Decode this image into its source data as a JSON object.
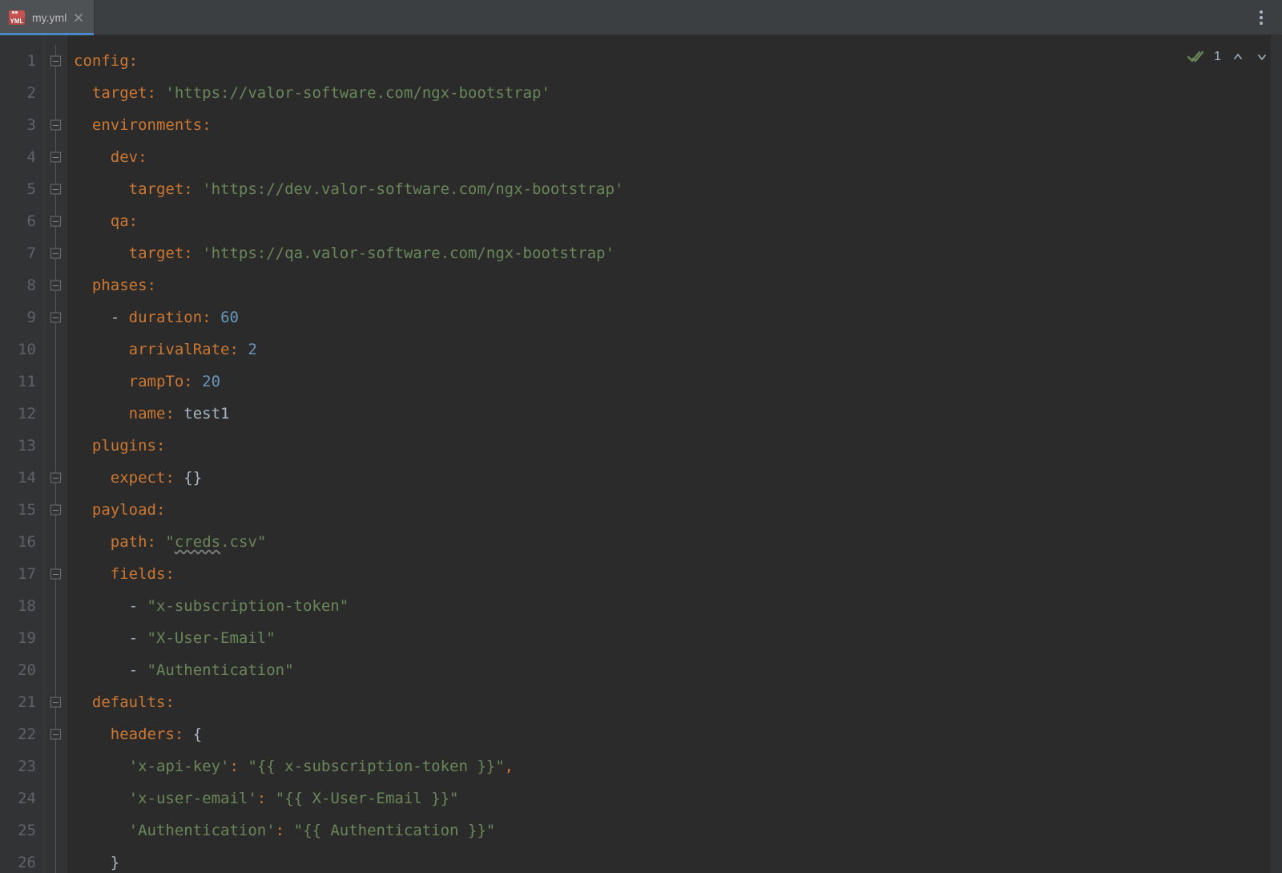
{
  "tab": {
    "filename": "my.yml",
    "icon_label": "YML"
  },
  "inspections": {
    "count": "1"
  },
  "gutter": {
    "start": 1,
    "end": 26
  },
  "fold_rows": [
    1,
    3,
    4,
    5,
    6,
    7,
    8,
    9,
    14,
    15,
    17,
    21,
    22
  ],
  "code_lines": [
    [
      {
        "t": "config",
        "c": "k"
      },
      {
        "t": ":",
        "c": "p"
      }
    ],
    [
      {
        "t": "  ",
        "c": "d"
      },
      {
        "t": "target",
        "c": "k"
      },
      {
        "t": ": ",
        "c": "p"
      },
      {
        "t": "'https://valor-software.com/ngx-bootstrap'",
        "c": "s"
      }
    ],
    [
      {
        "t": "  ",
        "c": "d"
      },
      {
        "t": "environments",
        "c": "k"
      },
      {
        "t": ":",
        "c": "p"
      }
    ],
    [
      {
        "t": "    ",
        "c": "d"
      },
      {
        "t": "dev",
        "c": "k"
      },
      {
        "t": ":",
        "c": "p"
      }
    ],
    [
      {
        "t": "      ",
        "c": "d"
      },
      {
        "t": "target",
        "c": "k"
      },
      {
        "t": ": ",
        "c": "p"
      },
      {
        "t": "'https://dev.valor-software.com/ngx-bootstrap'",
        "c": "s"
      }
    ],
    [
      {
        "t": "    ",
        "c": "d"
      },
      {
        "t": "qa",
        "c": "k"
      },
      {
        "t": ":",
        "c": "p"
      }
    ],
    [
      {
        "t": "      ",
        "c": "d"
      },
      {
        "t": "target",
        "c": "k"
      },
      {
        "t": ": ",
        "c": "p"
      },
      {
        "t": "'https://qa.valor-software.com/ngx-bootstrap'",
        "c": "s"
      }
    ],
    [
      {
        "t": "  ",
        "c": "d"
      },
      {
        "t": "phases",
        "c": "k"
      },
      {
        "t": ":",
        "c": "p"
      }
    ],
    [
      {
        "t": "    ",
        "c": "d"
      },
      {
        "t": "- ",
        "c": "dash"
      },
      {
        "t": "duration",
        "c": "k"
      },
      {
        "t": ": ",
        "c": "p"
      },
      {
        "t": "60",
        "c": "n"
      }
    ],
    [
      {
        "t": "      ",
        "c": "d"
      },
      {
        "t": "arrivalRate",
        "c": "k"
      },
      {
        "t": ": ",
        "c": "p"
      },
      {
        "t": "2",
        "c": "n"
      }
    ],
    [
      {
        "t": "      ",
        "c": "d"
      },
      {
        "t": "rampTo",
        "c": "k"
      },
      {
        "t": ": ",
        "c": "p"
      },
      {
        "t": "20",
        "c": "n"
      }
    ],
    [
      {
        "t": "      ",
        "c": "d"
      },
      {
        "t": "name",
        "c": "k"
      },
      {
        "t": ": ",
        "c": "p"
      },
      {
        "t": "test1",
        "c": "d"
      }
    ],
    [
      {
        "t": "  ",
        "c": "d"
      },
      {
        "t": "plugins",
        "c": "k"
      },
      {
        "t": ":",
        "c": "p"
      }
    ],
    [
      {
        "t": "    ",
        "c": "d"
      },
      {
        "t": "expect",
        "c": "k"
      },
      {
        "t": ": ",
        "c": "p"
      },
      {
        "t": "{}",
        "c": "br"
      }
    ],
    [
      {
        "t": "  ",
        "c": "d"
      },
      {
        "t": "payload",
        "c": "k"
      },
      {
        "t": ":",
        "c": "p"
      }
    ],
    [
      {
        "t": "    ",
        "c": "d"
      },
      {
        "t": "path",
        "c": "k"
      },
      {
        "t": ": ",
        "c": "p"
      },
      {
        "t": "\"",
        "c": "s"
      },
      {
        "t": "creds",
        "c": "s warn"
      },
      {
        "t": ".csv\"",
        "c": "s"
      }
    ],
    [
      {
        "t": "    ",
        "c": "d"
      },
      {
        "t": "fields",
        "c": "k"
      },
      {
        "t": ":",
        "c": "p"
      }
    ],
    [
      {
        "t": "      ",
        "c": "d"
      },
      {
        "t": "- ",
        "c": "dash"
      },
      {
        "t": "\"x-subscription-token\"",
        "c": "s"
      }
    ],
    [
      {
        "t": "      ",
        "c": "d"
      },
      {
        "t": "- ",
        "c": "dash"
      },
      {
        "t": "\"X-User-Email\"",
        "c": "s"
      }
    ],
    [
      {
        "t": "      ",
        "c": "d"
      },
      {
        "t": "- ",
        "c": "dash"
      },
      {
        "t": "\"Authentication\"",
        "c": "s"
      }
    ],
    [
      {
        "t": "  ",
        "c": "d"
      },
      {
        "t": "defaults",
        "c": "k"
      },
      {
        "t": ":",
        "c": "p"
      }
    ],
    [
      {
        "t": "    ",
        "c": "d"
      },
      {
        "t": "headers",
        "c": "k"
      },
      {
        "t": ": ",
        "c": "p"
      },
      {
        "t": "{",
        "c": "br"
      }
    ],
    [
      {
        "t": "      ",
        "c": "d"
      },
      {
        "t": "'x-api-key'",
        "c": "s"
      },
      {
        "t": ": ",
        "c": "p"
      },
      {
        "t": "\"{{ x-subscription-token }}\"",
        "c": "s"
      },
      {
        "t": ",",
        "c": "comma"
      }
    ],
    [
      {
        "t": "      ",
        "c": "d"
      },
      {
        "t": "'x-user-email'",
        "c": "s"
      },
      {
        "t": ": ",
        "c": "p"
      },
      {
        "t": "\"{{ X-User-Email }}\"",
        "c": "s"
      }
    ],
    [
      {
        "t": "      ",
        "c": "d"
      },
      {
        "t": "'Authentication'",
        "c": "s"
      },
      {
        "t": ": ",
        "c": "p"
      },
      {
        "t": "\"{{ Authentication }}\"",
        "c": "s"
      }
    ],
    [
      {
        "t": "    ",
        "c": "d"
      },
      {
        "t": "}",
        "c": "br"
      }
    ]
  ]
}
